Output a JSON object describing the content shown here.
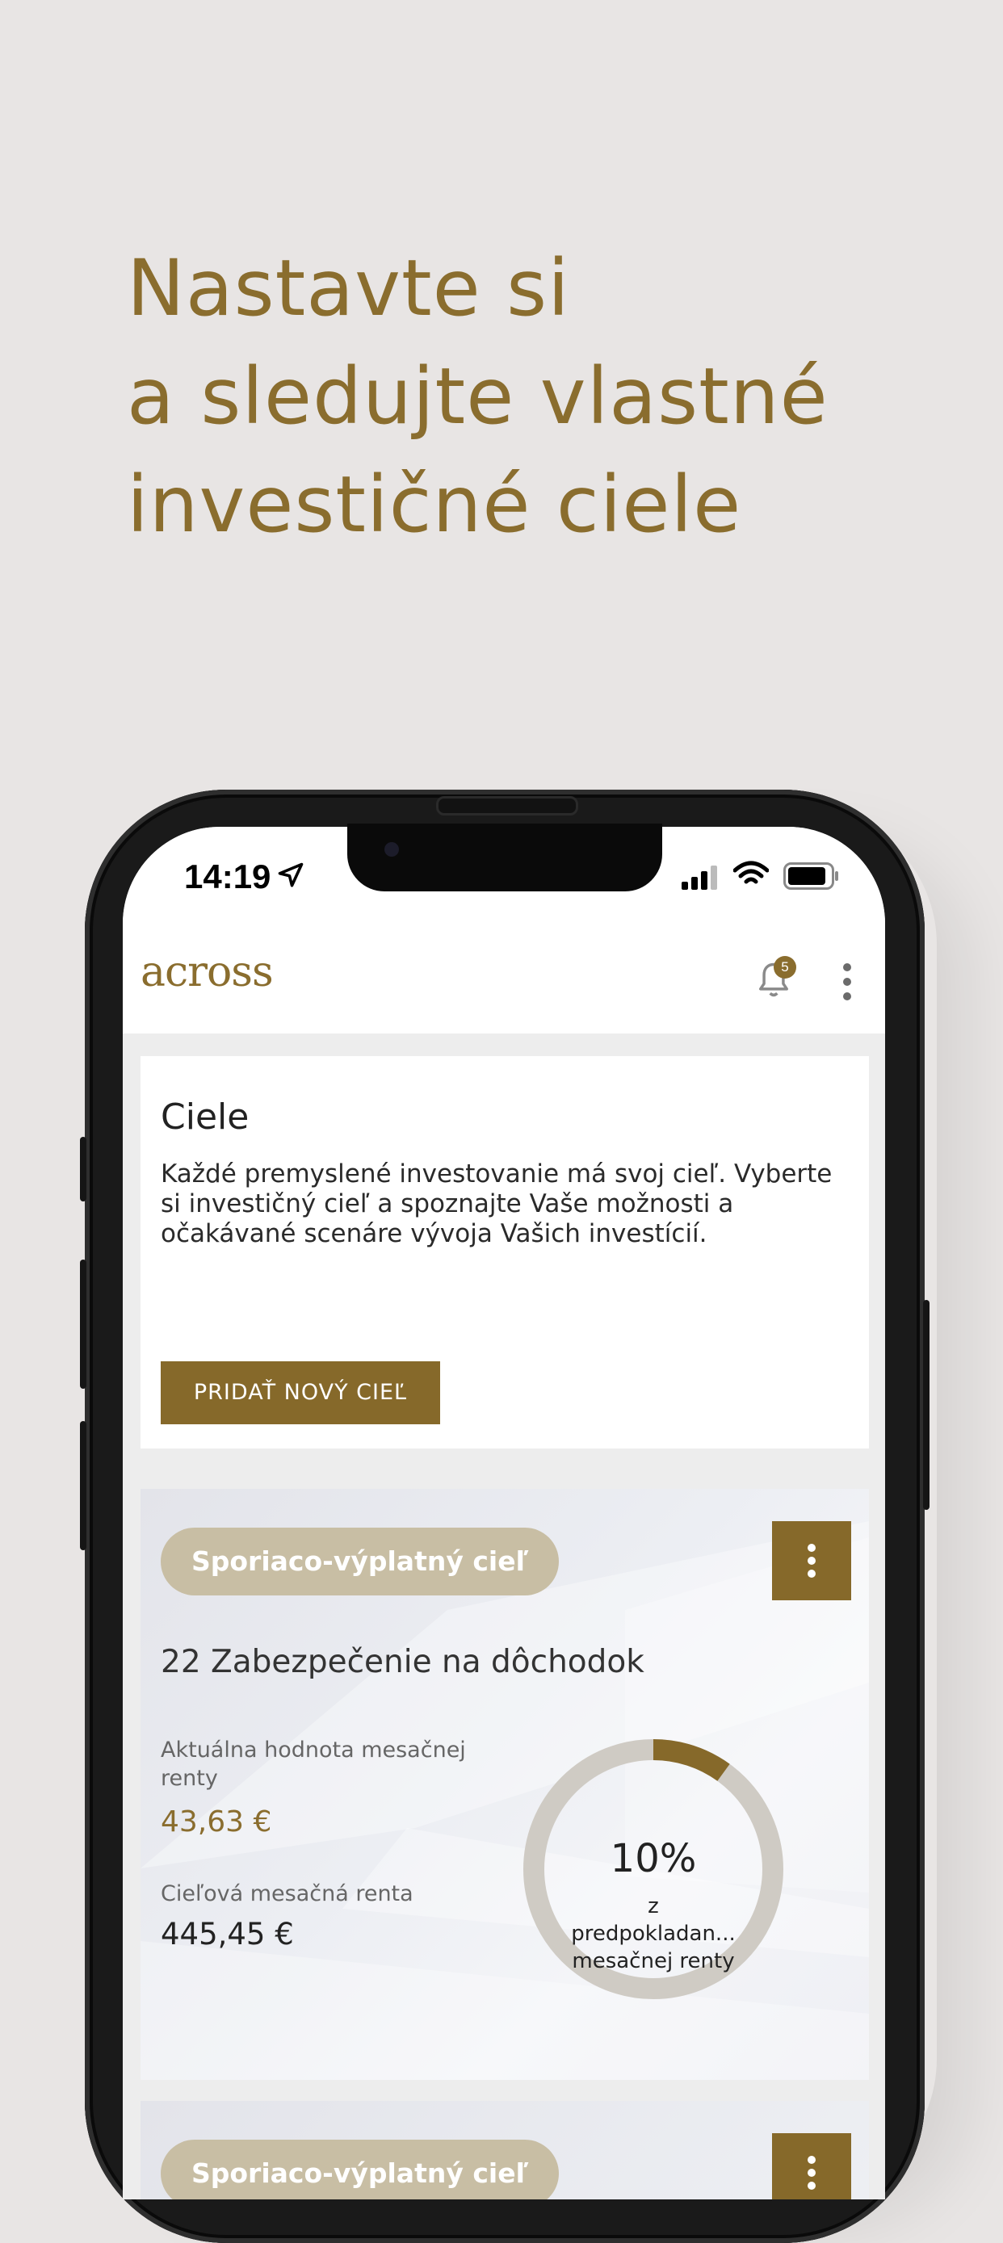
{
  "headline": [
    "Nastavte si",
    "a sledujte vlastné",
    "investičné ciele"
  ],
  "status_bar": {
    "time": "14:19"
  },
  "app_bar": {
    "logo": "across",
    "notification_count": "5"
  },
  "intro_card": {
    "title": "Ciele",
    "description": "Každé premyslené investovanie má svoj cieľ. Vyberte si investičný cieľ a spoznajte Vaše možnosti a očakávané scenáre vývoja Vašich investícií.",
    "add_button": "PRIDAŤ NOVÝ CIEĽ"
  },
  "goal_card": {
    "type_pill": "Sporiaco-výplatný cieľ",
    "name": "22 Zabezpečenie na dôchodok",
    "current_label": "Aktuálna hodnota mesačnej renty",
    "current_value": "43,63 €",
    "target_label": "Cieľová mesačná renta",
    "target_value": "445,45 €",
    "progress_percent_text": "10%",
    "progress_fraction": 0.1,
    "progress_caption_1": "z",
    "progress_caption_2": "predpokladan...",
    "progress_caption_3": "mesačnej renty"
  },
  "goal_card_2": {
    "type_pill": "Sporiaco-výplatný cieľ"
  },
  "colors": {
    "accent": "#86692a",
    "headline": "#8a6d2e",
    "pill": "#c8bea4",
    "ring_track": "#cfcbc4"
  }
}
